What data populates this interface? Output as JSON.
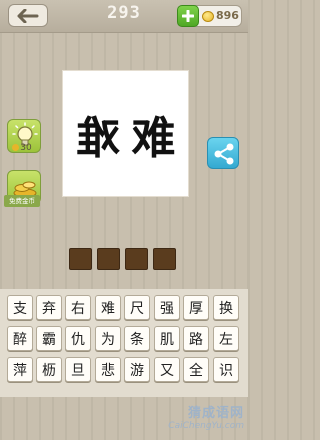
{
  "header": {
    "level": "293",
    "coins": "896"
  },
  "puzzle": {
    "chars": [
      "难",
      "难"
    ],
    "mirrored_first": true
  },
  "sidebar": {
    "hint_cost": "30",
    "free_coins_label": "免费金币"
  },
  "answer_slots": 4,
  "keyboard": {
    "rows": [
      [
        "支",
        "弃",
        "右",
        "难",
        "尺",
        "强",
        "厚",
        "换"
      ],
      [
        "醉",
        "霸",
        "仇",
        "为",
        "条",
        "肌",
        "路",
        "左"
      ],
      [
        "萍",
        "枥",
        "旦",
        "悲",
        "游",
        "又",
        "全",
        "识"
      ]
    ]
  },
  "watermark": {
    "site": "猜成语网",
    "url": "CaiChengYu.com"
  },
  "colors": {
    "accent_green": "#9cc33a",
    "share_blue": "#34a9d1",
    "slot_brown": "#5a3c1e",
    "background": "#c8bfae"
  },
  "icons": {
    "back": "arrow-left-icon",
    "plus": "plus-icon",
    "coin": "coin-icon",
    "hint": "lightbulb-icon",
    "free_coins": "coin-pile-icon",
    "share": "share-icon"
  }
}
